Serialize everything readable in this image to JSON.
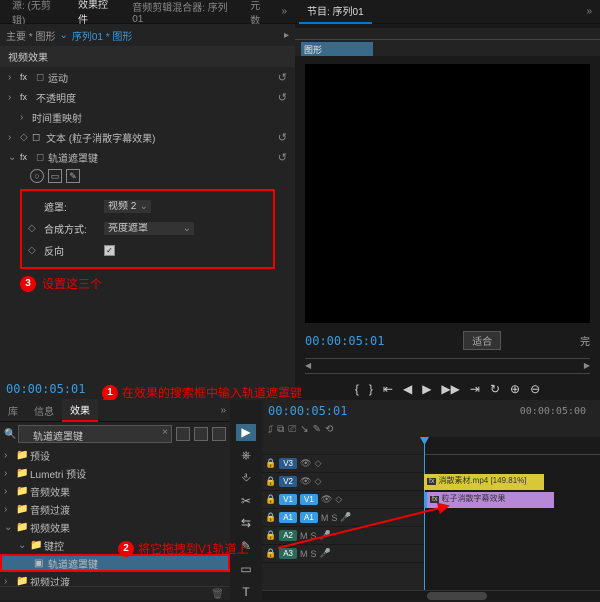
{
  "topTabs": {
    "source": "源: (无剪辑)",
    "effectControls": "效果控件",
    "audioMixer": "音频剪辑混合器: 序列01",
    "metadata": "元数",
    "sequence": "节目: 序列01"
  },
  "sourceRow": {
    "main": "主要 * 图形",
    "arrow": "⌄",
    "seq": "序列01 * 图形"
  },
  "categoryLabel": "视频效果",
  "miniClipLabel": "图形",
  "effects": {
    "motion": "运动",
    "opacity": "不透明度",
    "timeRemap": "时间重映射",
    "text": "文本 (粒子消散字幕效果)",
    "trackMatte": "轨道遮罩键"
  },
  "fxLabel": "fx",
  "props": {
    "matte": {
      "label": "遮罩:",
      "value": "视频 2"
    },
    "composite": {
      "label": "合成方式:",
      "value": "亮度遮罩"
    },
    "reverse": {
      "label": "反向",
      "checked": true
    }
  },
  "tcLeft": "00:00:05:01",
  "preview": {
    "tc": "00:00:05:01",
    "fit": "适合",
    "full": "完"
  },
  "transport": [
    "⇤",
    "◀",
    "▶",
    "▶▶",
    "⇥",
    "↻",
    "⊕",
    "⊖"
  ],
  "ann": {
    "a1": "在效果的搜索框中输入轨道遮罩键",
    "a2": "将它拖拽到V1轨道上",
    "a3": "设置这三个"
  },
  "effTabs": {
    "lib": "库",
    "info": "信息",
    "fx": "效果"
  },
  "search": {
    "value": "轨道遮罩键",
    "clear": "×"
  },
  "tree": {
    "presets": "预设",
    "lumetri": "Lumetri 预设",
    "audioFx": "音频效果",
    "audioTrans": "音频过渡",
    "videoFx": "视频效果",
    "keying": "键控",
    "trackMatte": "轨道遮罩键",
    "videoTrans": "视频过渡"
  },
  "tools": [
    "▶",
    "⎈",
    "⎀",
    "✂",
    "⇆",
    "✎",
    "▭",
    "T"
  ],
  "timeline": {
    "tc": "00:00:05:01",
    "tc2": "00:00:05:00",
    "icons": [
      "⎎",
      "⧉",
      "⎚",
      "↘",
      "✎",
      "⟲"
    ],
    "tracks": {
      "v3": "V3",
      "v2": "V2",
      "v1": "V1",
      "a1": "A1",
      "a2": "A2",
      "a3": "A3"
    },
    "toggles": {
      "eye": "👁",
      "lock": "🔒",
      "mute": "M",
      "solo": "S",
      "mic": "🎤"
    },
    "clipV2": "消散素材.mp4 [149.81%]",
    "clipV1": "粒子消散字幕效果"
  }
}
